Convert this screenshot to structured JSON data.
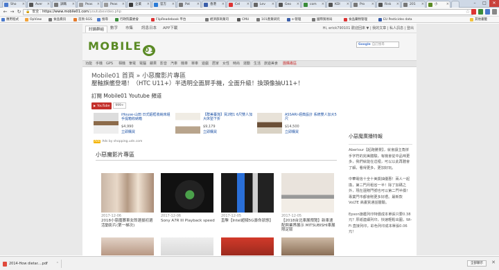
{
  "browser": {
    "tabs": [
      {
        "label": "Sho",
        "active": false,
        "fav": "#4a79cc"
      },
      {
        "label": "Aver",
        "active": false,
        "fav": "#555"
      },
      {
        "label": "調職",
        "active": false,
        "fav": "#777"
      },
      {
        "label": "Peas",
        "active": false,
        "fav": "#999"
      },
      {
        "label": "Peas",
        "active": false,
        "fav": "#999"
      },
      {
        "label": "企業",
        "active": false,
        "fav": "#3a3a3a"
      },
      {
        "label": "官方",
        "active": false,
        "fav": "#2b7bd6"
      },
      {
        "label": "Pot",
        "active": false,
        "fav": "#777"
      },
      {
        "label": "香港",
        "active": false,
        "fav": "#3a5ea9"
      },
      {
        "label": "Cel",
        "active": false,
        "fav": "#d33"
      },
      {
        "label": "Lev",
        "active": false,
        "fav": "#666"
      },
      {
        "label": "Geo",
        "active": false,
        "fav": "#555"
      },
      {
        "label": "com",
        "active": false,
        "fav": "#3a8c3a"
      },
      {
        "label": "KDI",
        "active": false,
        "fav": "#555"
      },
      {
        "label": "Pro",
        "active": false,
        "fav": "#777"
      },
      {
        "label": "Risk",
        "active": false,
        "fav": "#555"
      },
      {
        "label": "201",
        "active": false,
        "fav": "#777"
      },
      {
        "label": "小",
        "active": true,
        "fav": "#5a8a24"
      }
    ],
    "window_buttons": {
      "minimize": "–",
      "maximize": "□",
      "close": "✕"
    },
    "url": {
      "secure_label": "安全",
      "host": "https://www.mobile01.com",
      "path": "/youtubevideo.php"
    },
    "bookmarks": [
      {
        "label": "應用程式",
        "color": "#4a79cc"
      },
      {
        "label": "OpView",
        "color": "#f2a33a"
      },
      {
        "label": "食品資訊",
        "color": "#777"
      },
      {
        "label": "首頁-SGS",
        "color": "#e57a2a"
      },
      {
        "label": "搜尋",
        "color": "#4a79cc"
      },
      {
        "label": "行政院農委會",
        "color": "#3a8c3a"
      },
      {
        "label": "FlipReadebook 平台",
        "color": "#d33"
      },
      {
        "label": "經濟部商業司",
        "color": "#777"
      },
      {
        "label": "CMU",
        "color": "#555"
      },
      {
        "label": "101產業研究",
        "color": "#777"
      },
      {
        "label": "e-管理",
        "color": "#3a5ea9"
      },
      {
        "label": "國際貿易局",
        "color": "#777"
      },
      {
        "label": "食品藥物管理",
        "color": "#d33"
      },
      {
        "label": "EU Pesticides data",
        "color": "#3a5ea9"
      },
      {
        "label": "其他書籤",
        "color": "#f2c33a"
      }
    ]
  },
  "site": {
    "topnav": [
      "討論群組",
      "數字",
      "市集",
      "訊息日本",
      "APP下載"
    ],
    "user_links": "Hi, erick790101  歡迎回來 ▼   | 我的文章  |  私人訊息  |  登出",
    "logo_text": "MOBILE",
    "logo_digit": "01",
    "search_placeholder": "自訂搜尋",
    "search_brand": "Google",
    "categories": [
      "功能",
      "手機",
      "GPS",
      "相機",
      "筆電",
      "電腦",
      "蘋果",
      "影音",
      "汽車",
      "機車",
      "單車",
      "遊戲",
      "居家",
      "女性",
      "時尚",
      "運動",
      "生活",
      "旅遊美食",
      "團購專區"
    ]
  },
  "content": {
    "breadcrumb": "Mobile01 首頁 » 小惡魔影片專區",
    "headline": "壓軸旗艦登場！（HTC U11+）半透明全面屏手機，全面升級！換頭像抽U11+！",
    "subscribe_title": "訂閱 Mobile01 Youtube 頻道",
    "youtube_label": "YouTube",
    "youtube_count": "999+",
    "ads": [
      {
        "title": "iHouse-山田 日式鋁框收納床組 手提箱收納箱",
        "price": "$4,990",
        "cta": "立即購買"
      },
      {
        "title": "【群美臺灣】買2贈1 6尺雙人加大床墊下折",
        "price": "$9,179",
        "cta": "立即購買"
      },
      {
        "title": "ASSARI-經典設計 系統雙人加大5尺",
        "price": "$14,500",
        "cta": "立即購買"
      }
    ],
    "ads_footer": "Ads by shopping.udn.com",
    "section_title": "小惡魔影片專區",
    "videos": [
      {
        "date": "2017-12-06",
        "title": "2018小惡魔賽車女郎選拔初選活動影片(第一梯次)"
      },
      {
        "date": "2017-12-06",
        "title": "Sony A7R III Playback speed"
      },
      {
        "date": "2017-12-05",
        "title": "直擊【Intel超頻5G壽命狀態】"
      },
      {
        "date": "2017-12-05",
        "title": "【2018台北車展預覽】新車速配與業界展示 MITSUBISHI車展限定版"
      }
    ],
    "sidebar_title": "小惡魔廣播特報",
    "sidebar_paras": [
      "Aberlour【起跑勝景】，就會讓主角拼手字符的完美體驗，有機會從中品味更多，我們就能在這裡，可以以此再體會了解，看得更多，更加好玩。",
      "中華電信十全十美獎抽優惠！兩人一起換，第二門月租省一半！除了加碼之外，現在還贈門號也可以第二門半價！專業門市都會贈更多好禮。最新款VoLTE 高畫質通話體驗。",
      "Epson旗艦列印特價成本單張只要0.38元？厚紙連續列印，快速輕鬆出圖，Wi-Fi 直接列印，彩色列印成本單張0.06元！"
    ]
  },
  "downloads": {
    "file": "2014-How dietar....pdf",
    "show_all": "全部顯示"
  }
}
